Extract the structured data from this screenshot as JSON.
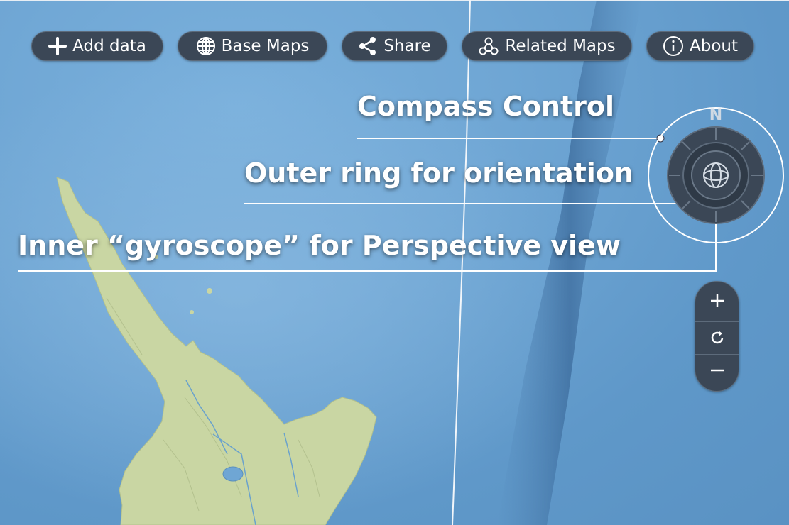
{
  "toolbar": {
    "add_data": "Add data",
    "base_maps": "Base Maps",
    "share": "Share",
    "related_maps": "Related Maps",
    "about": "About"
  },
  "annotations": {
    "compass_control": "Compass Control",
    "outer_ring": "Outer ring for orientation",
    "inner_gyroscope": "Inner “gyroscope” for Perspective view"
  },
  "compass": {
    "north_label": "N"
  },
  "icons": {
    "add_data": "plus-icon",
    "base_maps": "globe-icon",
    "share": "share-icon",
    "related_maps": "related-maps-icon",
    "about": "info-icon",
    "compass_center": "gyroscope-icon",
    "zoom_in": "plus-icon",
    "reset": "refresh-icon",
    "zoom_out": "minus-icon"
  },
  "colors": {
    "ocean": "#6fa6d4",
    "land": "#c9d6a3",
    "control_bg": "#3b4756",
    "text": "#ffffff"
  }
}
